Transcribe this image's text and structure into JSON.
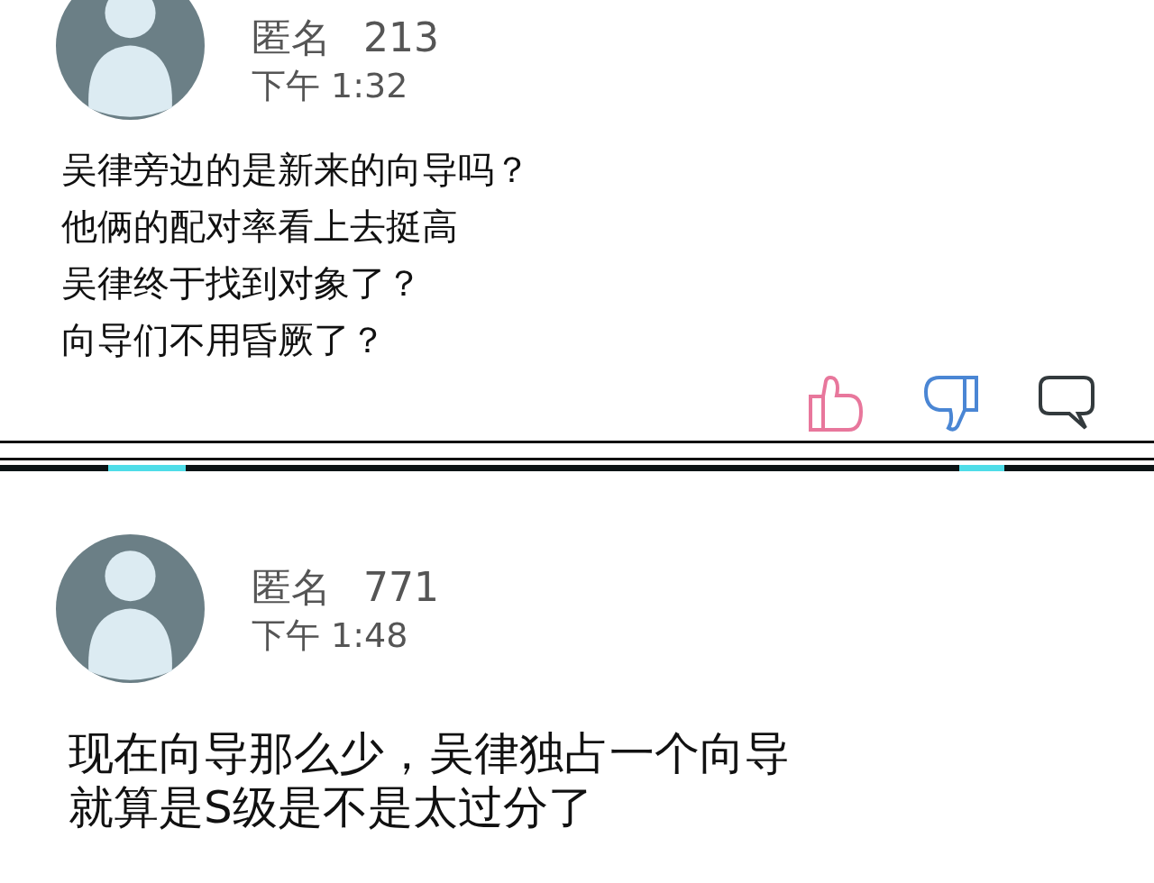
{
  "comments": [
    {
      "name": "匿名",
      "number": "213",
      "time": "下午 1:32",
      "lines": [
        "吴律旁边的是新来的向导吗？",
        "他俩的配对率看上去挺高",
        "吴律终于找到对象了？",
        "向导们不用昏厥了？"
      ],
      "actions": [
        {
          "kind": "like"
        },
        {
          "kind": "dislike"
        },
        {
          "kind": "reply"
        }
      ]
    },
    {
      "name": "匿名",
      "number": "771",
      "time": "下午 1:48",
      "lines": [
        "现在向导那么少，吴律独占一个向导",
        "就算是S级是不是太过分了"
      ]
    }
  ]
}
